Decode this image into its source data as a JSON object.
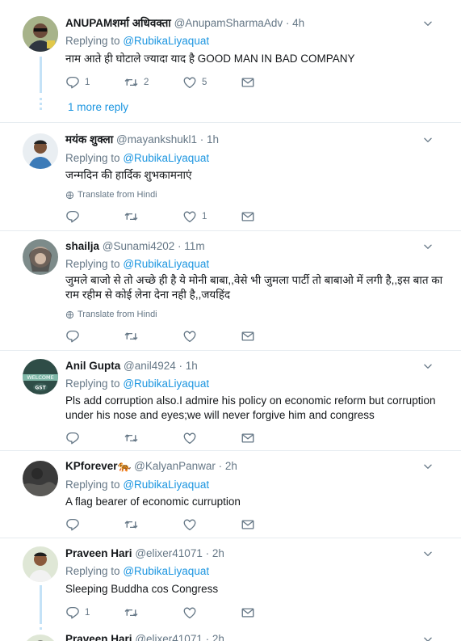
{
  "replying_label": "Replying to",
  "translate_label": "Translate from Hindi",
  "tweets": [
    {
      "name": "ANUPAMशर्मा अधिवक्ता",
      "handle": "@AnupamSharmaAdv · 4h",
      "mention": "@RubikaLiyaquat",
      "text": "नाम आते ही घोटाले ज्यादा याद है GOOD MAN IN BAD COMPANY",
      "replies": "1",
      "retweets": "2",
      "likes": "5",
      "more_reply": "1 more reply"
    },
    {
      "name": "मयंक शुक्ला",
      "handle": "@mayankshukl1 · 1h",
      "mention": "@RubikaLiyaquat",
      "text": "जन्मदिन की हार्दिक शुभकामनाएं",
      "replies": "",
      "retweets": "",
      "likes": "1"
    },
    {
      "name": "shailja",
      "handle": "@Sunami4202 · 11m",
      "mention": "@RubikaLiyaquat",
      "text": "जुमले बाजो से तो अच्छे ही है ये मोनी बाबा,,वेसे भी जुमला पार्टी तो बाबाओ में लगी है,,इस बात का राम रहीम से कोई लेना देना नही है,,जयहिंद",
      "replies": "",
      "retweets": "",
      "likes": ""
    },
    {
      "name": "Anil Gupta",
      "handle": "@anil4924 · 1h",
      "mention": "@RubikaLiyaquat",
      "text": "Pls add corruption also.I admire his policy on economic reform but corruption under his nose and eyes;we will never forgive him and congress",
      "avatar_text": "WELCOME GST",
      "replies": "",
      "retweets": "",
      "likes": ""
    },
    {
      "name": "KPforever🐅",
      "handle": "@KalyanPanwar · 2h",
      "mention": "@RubikaLiyaquat",
      "text": "A flag bearer of economic curruption",
      "replies": "",
      "retweets": "",
      "likes": ""
    },
    {
      "name": "Praveen Hari",
      "handle": "@elixer41071 · 2h",
      "mention": "@RubikaLiyaquat",
      "text": "Sleeping Buddha cos Congress",
      "replies": "1",
      "retweets": "",
      "likes": ""
    },
    {
      "name": "Praveen Hari",
      "handle": "@elixer41071 · 2h"
    }
  ]
}
